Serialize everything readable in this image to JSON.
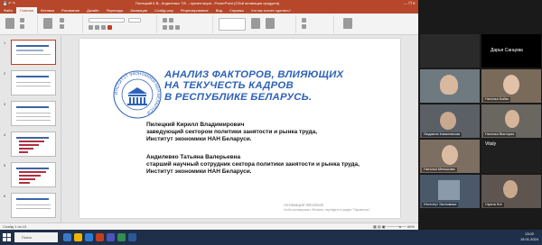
{
  "window": {
    "title": "Пилецкий К.В., Андилевко Т.В. - презентация - PowerPoint (Сбой активации продукта)",
    "controls": "— ❐ ✕",
    "qat": "💾 ↶ ↷"
  },
  "ribbon": {
    "tabs": [
      "Файл",
      "Главная",
      "Вставка",
      "Рисование",
      "Дизайн",
      "Переходы",
      "Анимация",
      "Слайд-шоу",
      "Рецензирование",
      "Вид",
      "Справка",
      "Что вы хотите сделать?"
    ]
  },
  "thumbnails": [
    {
      "num": "1",
      "selected": true
    },
    {
      "num": "2",
      "selected": false
    },
    {
      "num": "3",
      "selected": false
    },
    {
      "num": "4",
      "selected": false
    },
    {
      "num": "5",
      "selected": false
    },
    {
      "num": "6",
      "selected": false
    }
  ],
  "slide": {
    "title": "АНАЛИЗ ФАКТОРОВ, ВЛИЯЮЩИХ\nНА ТЕКУЧЕСТЬ КАДРОВ\nВ РЕСПУБЛИКЕ БЕЛАРУСЬ.",
    "logo_ring_text": "ИНСТИТУТ ЭКОНОМИКИ НАН БЕЛАРУСИ",
    "author1": {
      "name": "Пилецкий Кирилл Владимирович",
      "position": "заведующий сектором политики занятости и рынка труда,",
      "org": "Институт экономики НАН Беларуси."
    },
    "author2": {
      "name": "Андилевко Татьяна Валерьевна",
      "position": "старший научный сотрудник сектора политики занятости и рынка труда,",
      "org": "Институт экономики НАН Беларуси."
    },
    "watermark": {
      "line1": "Активация Windows",
      "line2": "Чтобы активировать Windows, перейдите в раздел \"Параметры\"."
    }
  },
  "statusbar": {
    "left": "Слайд 1 из 10",
    "right": "▦ ▤ ▣ ─────●── 66%"
  },
  "participants": [
    {
      "name": "Екатерина Сологубова",
      "initials": "",
      "color": "#5a6a7a"
    },
    {
      "name": "Дарья Санцова",
      "initials": "",
      "color": "#000000"
    },
    {
      "name": "",
      "initials": "",
      "color": "#6f7a80"
    },
    {
      "name": "Наталья Байко",
      "initials": "",
      "color": "#7a6a5a"
    },
    {
      "name": "Людмила Ковалевская",
      "initials": "",
      "color": "#5b5f66"
    },
    {
      "name": "Наталья Виктория",
      "initials": "",
      "color": "#6a6660"
    },
    {
      "name": "Наталья Меньшова",
      "initials": "",
      "color": "#7d6e62"
    },
    {
      "name": "Vitaly",
      "initials": "",
      "color": "#1f1f1f"
    },
    {
      "name": "Институт Экономики",
      "initials": "",
      "color": "#4a5868"
    },
    {
      "name": "Ulyana Kot",
      "initials": "",
      "color": "#5e5450"
    }
  ],
  "panel_header": {
    "name": "Дарья Санцова"
  },
  "panel_tile8": {
    "name": "Vitaly"
  },
  "taskbar": {
    "search_placeholder": "Поиск",
    "time": "13:02",
    "date": "15.01.2024"
  }
}
